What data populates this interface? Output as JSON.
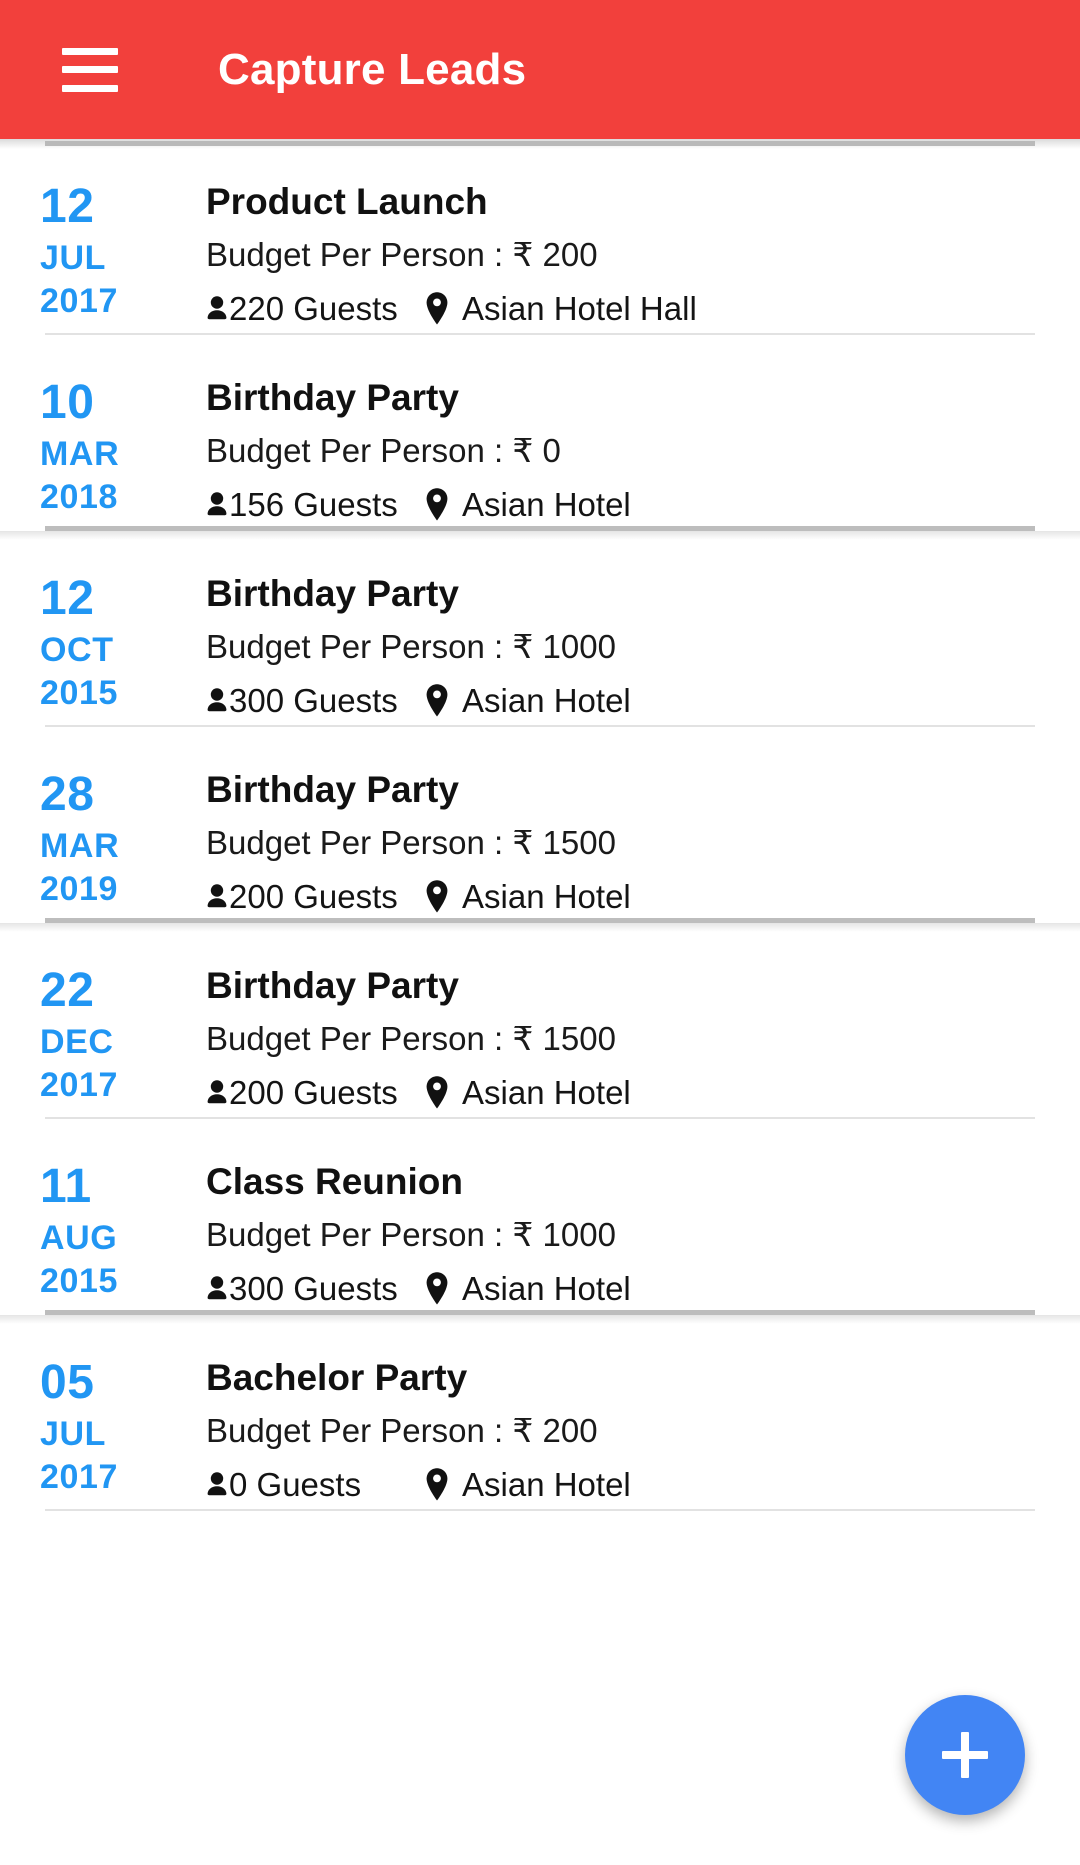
{
  "appbar": {
    "menu_icon": "hamburger-menu-icon",
    "title": "Capture Leads",
    "background_color": "#F2403C",
    "text_color": "#FFFFFF"
  },
  "theme": {
    "date_color": "#2196F3",
    "fab_color": "#4285F4",
    "divider_color": "#E2E2E2"
  },
  "labels": {
    "budget_prefix": "Budget Per Person : ",
    "currency_symbol": "₹",
    "guests_suffix": " Guests",
    "person_icon": "person-icon",
    "location_icon": "map-pin-icon"
  },
  "fab": {
    "icon": "plus-icon",
    "label": "+"
  },
  "events": [
    {
      "day": "12",
      "month": "JUL",
      "year": "2017",
      "title": "Product Launch",
      "budget": "Budget Per Person : ₹ 200",
      "budget_value": "200",
      "guests": "220 Guests",
      "guests_count": "220",
      "venue": "Asian Hotel Hall",
      "divider": "light"
    },
    {
      "day": "10",
      "month": "MAR",
      "year": "2018",
      "title": "Birthday Party",
      "budget": "Budget Per Person : ₹ 0",
      "budget_value": "0",
      "guests": "156 Guests",
      "guests_count": "156",
      "venue": "Asian Hotel",
      "divider": "strong"
    },
    {
      "day": "12",
      "month": "OCT",
      "year": "2015",
      "title": "Birthday Party",
      "budget": "Budget Per Person : ₹ 1000",
      "budget_value": "1000",
      "guests": "300 Guests",
      "guests_count": "300",
      "venue": "Asian Hotel",
      "divider": "light"
    },
    {
      "day": "28",
      "month": "MAR",
      "year": "2019",
      "title": "Birthday Party",
      "budget": "Budget Per Person : ₹ 1500",
      "budget_value": "1500",
      "guests": "200 Guests",
      "guests_count": "200",
      "venue": "Asian Hotel",
      "divider": "strong"
    },
    {
      "day": "22",
      "month": "DEC",
      "year": "2017",
      "title": "Birthday Party",
      "budget": "Budget Per Person : ₹ 1500",
      "budget_value": "1500",
      "guests": "200 Guests",
      "guests_count": "200",
      "venue": "Asian Hotel",
      "divider": "light"
    },
    {
      "day": "11",
      "month": "AUG",
      "year": "2015",
      "title": "Class Reunion",
      "budget": "Budget Per Person : ₹ 1000",
      "budget_value": "1000",
      "guests": "300 Guests",
      "guests_count": "300",
      "venue": "Asian Hotel",
      "divider": "strong"
    },
    {
      "day": "05",
      "month": "JUL",
      "year": "2017",
      "title": "Bachelor Party",
      "budget": "Budget Per Person : ₹ 200",
      "budget_value": "200",
      "guests": "0 Guests",
      "guests_count": "0",
      "venue": "Asian Hotel",
      "divider": "light"
    }
  ]
}
